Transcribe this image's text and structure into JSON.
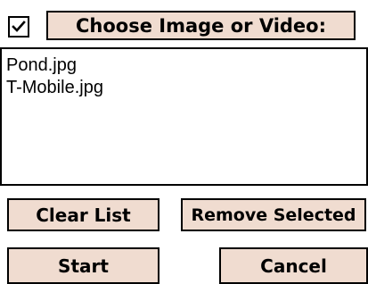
{
  "header": {
    "checkbox_checked": true,
    "choose_label": "Choose Image or Video:"
  },
  "file_list": {
    "items": [
      {
        "label": "Pond.jpg"
      },
      {
        "label": "T-Mobile.jpg"
      }
    ]
  },
  "actions": {
    "clear_label": "Clear List",
    "remove_label": "Remove Selected",
    "start_label": "Start",
    "cancel_label": "Cancel"
  },
  "colors": {
    "button_face": "#f0dcd0",
    "border": "#000000",
    "background": "#ffffff"
  },
  "icons": {
    "checkbox": "checkmark-icon"
  }
}
